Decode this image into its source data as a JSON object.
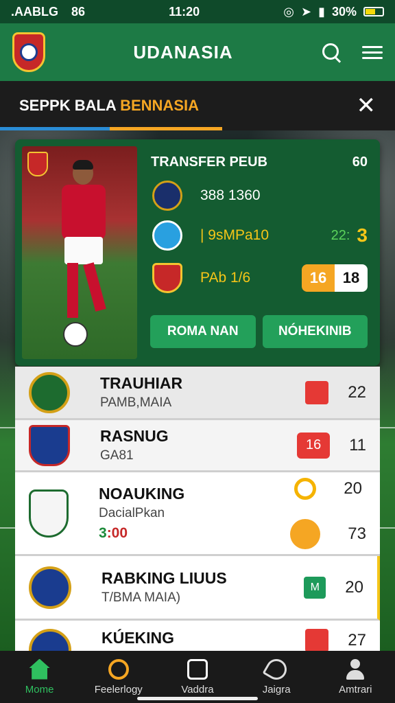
{
  "status_bar": {
    "carrier": ".AABLG",
    "network": "86",
    "time": "11:20",
    "battery_pct": "30%"
  },
  "header": {
    "title": "UDANASIA"
  },
  "title_strip": {
    "title_main": "SEPPK BALA ",
    "title_accent": "BENNASIA"
  },
  "transfer_card": {
    "heading": "TRANSFER PEUB",
    "heading_value": "60",
    "rows": [
      {
        "text": "388 1360"
      },
      {
        "text": "| 9sMPa10",
        "score_a": "22:",
        "score_b": "3"
      },
      {
        "text": "PAb 1/6",
        "pill_a": "16",
        "pill_b": "18"
      }
    ],
    "buttons": [
      "ROMA NAN",
      "NÓHEKINIB"
    ]
  },
  "list": [
    {
      "title": "TRAUHIAR",
      "subtitle": "PAMB,MAIA",
      "value": "22"
    },
    {
      "title": "RASNUG",
      "subtitle": "GA81",
      "badge": "16",
      "value": "11"
    },
    {
      "title": "NOAUKING",
      "subtitle": "DacialPkan",
      "score_g": "3",
      "score_r": ":00",
      "value1": "20",
      "value2": "73"
    },
    {
      "title": "RABKING LIUUS",
      "subtitle": "T/BMA MAIA)",
      "badge": "M",
      "value": "20"
    },
    {
      "title": "KÚEKING",
      "value": "27"
    }
  ],
  "bottom_nav": [
    {
      "label": "Mome"
    },
    {
      "label": "Feelerlogy"
    },
    {
      "label": "Vaddra"
    },
    {
      "label": "Jaigra"
    },
    {
      "label": "Amtrari"
    }
  ],
  "colors": {
    "brand_green": "#1d7a45",
    "accent_orange": "#f5a623",
    "alert_red": "#e53935"
  }
}
